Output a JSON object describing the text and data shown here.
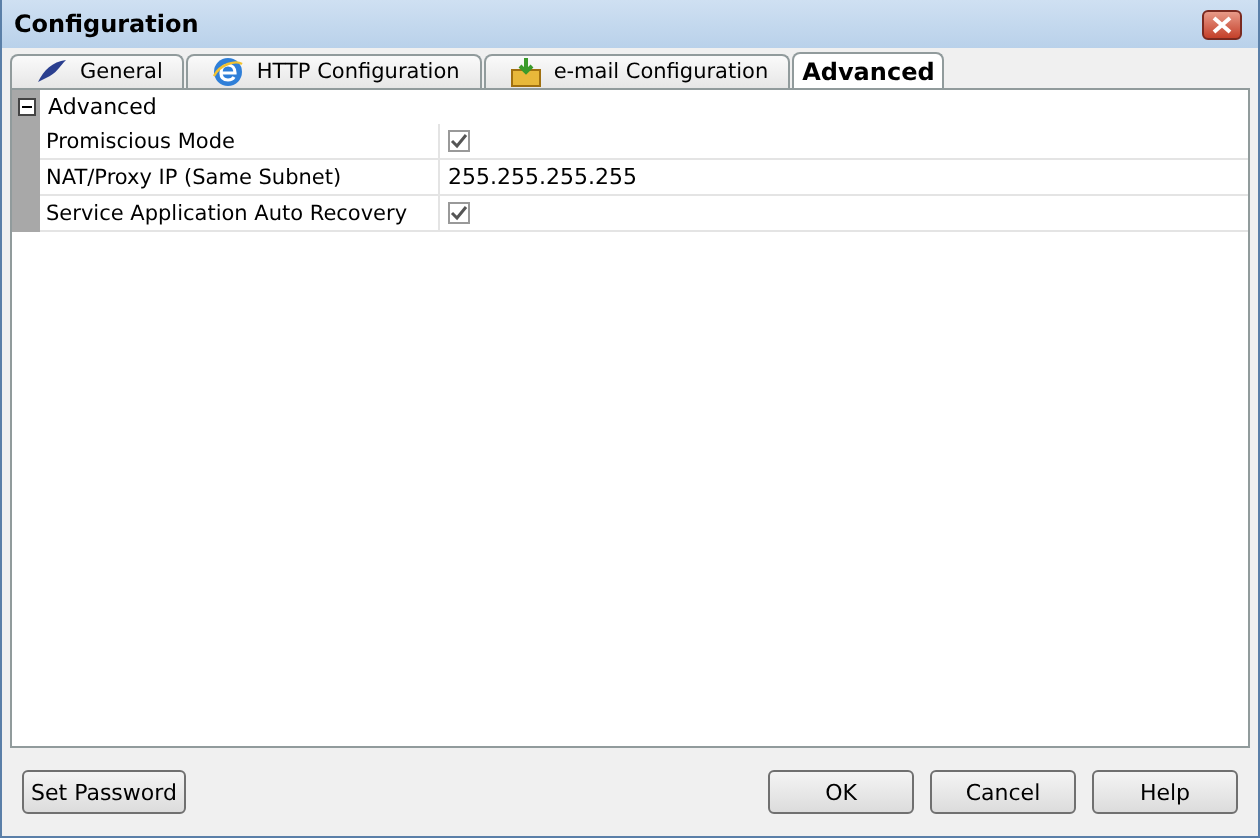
{
  "window": {
    "title": "Configuration"
  },
  "tabs": [
    {
      "label": "General",
      "selected": false
    },
    {
      "label": "HTTP Configuration",
      "selected": false
    },
    {
      "label": "e-mail Configuration",
      "selected": false
    },
    {
      "label": "Advanced",
      "selected": true
    }
  ],
  "category": {
    "label": "Advanced",
    "expanded": true
  },
  "properties": [
    {
      "name": "Promiscious Mode",
      "kind": "checkbox",
      "checked": true
    },
    {
      "name": "NAT/Proxy IP (Same Subnet)",
      "kind": "text",
      "value": "255.255.255.255"
    },
    {
      "name": "Service Application Auto Recovery",
      "kind": "checkbox",
      "checked": true
    }
  ],
  "left_buttons": [
    "Set Password"
  ],
  "right_buttons": [
    "OK",
    "Cancel",
    "Help"
  ]
}
